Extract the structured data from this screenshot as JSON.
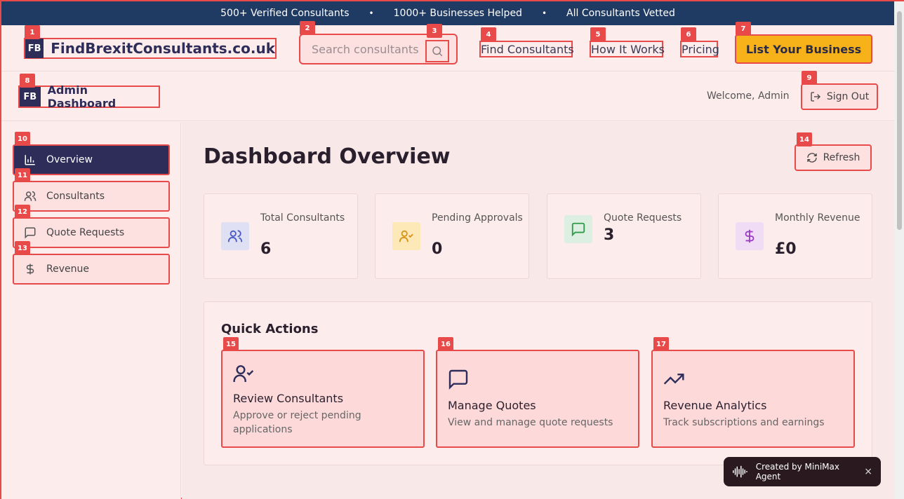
{
  "banner": {
    "items": [
      "500+ Verified Consultants",
      "1000+ Businesses Helped",
      "All Consultants Vetted"
    ],
    "separator": "•"
  },
  "header": {
    "logo": "FB",
    "brand": "FindBrexitConsultants.co.uk",
    "search_placeholder": "Search consultants",
    "nav": [
      "Find Consultants",
      "How It Works",
      "Pricing"
    ],
    "cta": "List Your Business"
  },
  "admin": {
    "logo": "FB",
    "title": "Admin Dashboard",
    "welcome": "Welcome, Admin",
    "signout": "Sign Out"
  },
  "sidebar": {
    "items": [
      {
        "label": "Overview",
        "icon": "bar-chart-icon",
        "active": true
      },
      {
        "label": "Consultants",
        "icon": "users-icon",
        "active": false
      },
      {
        "label": "Quote Requests",
        "icon": "message-square-icon",
        "active": false
      },
      {
        "label": "Revenue",
        "icon": "dollar-icon",
        "active": false
      }
    ]
  },
  "main": {
    "title": "Dashboard Overview",
    "refresh": "Refresh",
    "stats": [
      {
        "label": "Total Consultants",
        "value": "6",
        "icon": "users-icon",
        "color": "#4a5bc4",
        "bg": "#e0e0f5"
      },
      {
        "label": "Pending Approvals",
        "value": "0",
        "icon": "user-check-icon",
        "color": "#d99316",
        "bg": "#fde8b8"
      },
      {
        "label": "Quote Requests",
        "value": "3",
        "icon": "message-square-icon",
        "color": "#2f9a4a",
        "bg": "#dcefe0"
      },
      {
        "label": "Monthly Revenue",
        "value": "£0",
        "icon": "dollar-icon",
        "color": "#9b3cc4",
        "bg": "#f0dcf5"
      }
    ],
    "quick_actions": {
      "title": "Quick Actions",
      "cards": [
        {
          "title": "Review Consultants",
          "desc": "Approve or reject pending applications",
          "icon": "user-check-icon"
        },
        {
          "title": "Manage Quotes",
          "desc": "View and manage quote requests",
          "icon": "message-square-icon"
        },
        {
          "title": "Revenue Analytics",
          "desc": "Track subscriptions and earnings",
          "icon": "trending-up-icon"
        }
      ]
    }
  },
  "toast": {
    "text": "Created by MiniMax Agent",
    "close": "×"
  },
  "markers": [
    "1",
    "2",
    "3",
    "4",
    "5",
    "6",
    "7",
    "8",
    "9",
    "10",
    "11",
    "12",
    "13",
    "14",
    "15",
    "16",
    "17"
  ]
}
